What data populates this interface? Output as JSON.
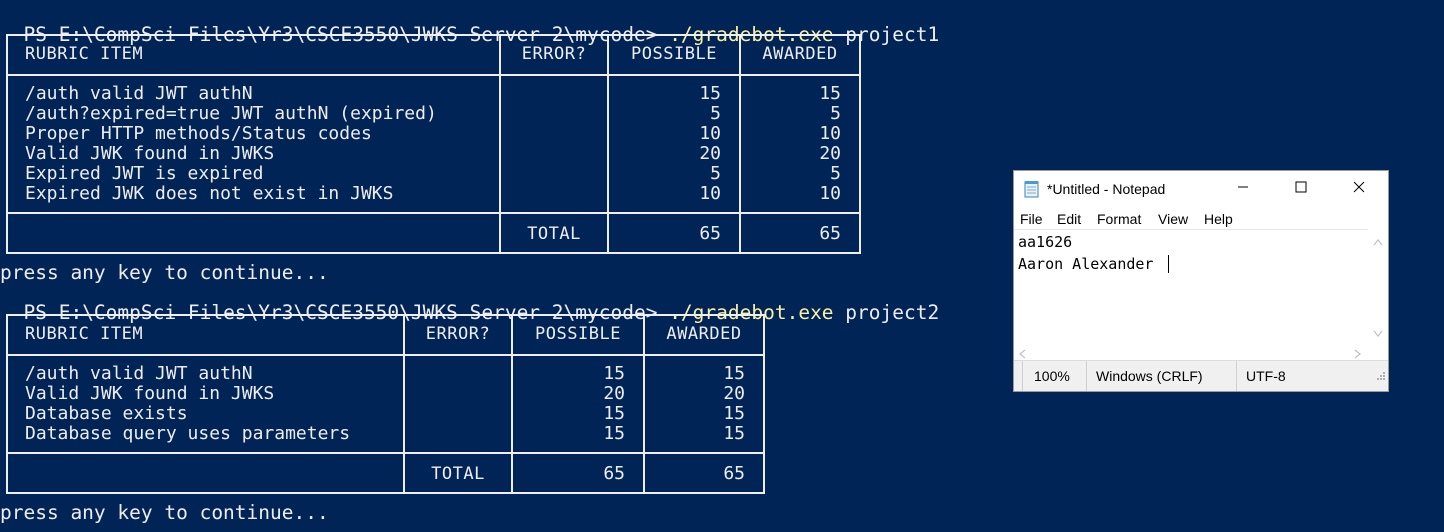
{
  "terminal": {
    "cmd1_prompt": "PS E:\\CompSci Files\\Yr3\\CSCE3550\\JWKS Server 2\\mycode> ",
    "cmd1_exe": "./gradebot.exe",
    "cmd1_arg": " project1",
    "cmd2_prompt": "PS E:\\CompSci Files\\Yr3\\CSCE3550\\JWKS Server 2\\mycode> ",
    "cmd2_exe": "./gradebot.exe",
    "cmd2_arg": " project2",
    "continue1": "press any key to continue...",
    "continue2": "press any key to continue...",
    "table1": {
      "headers": [
        "RUBRIC ITEM",
        "ERROR?",
        "POSSIBLE",
        "AWARDED"
      ],
      "rows": [
        {
          "item": "/auth valid JWT authN",
          "possible": "15",
          "awarded": "15"
        },
        {
          "item": "/auth?expired=true JWT authN (expired)",
          "possible": "5",
          "awarded": "5"
        },
        {
          "item": "Proper HTTP methods/Status codes",
          "possible": "10",
          "awarded": "10"
        },
        {
          "item": "Valid JWK found in JWKS",
          "possible": "20",
          "awarded": "20"
        },
        {
          "item": "Expired JWT is expired",
          "possible": "5",
          "awarded": "5"
        },
        {
          "item": "Expired JWK does not exist in JWKS",
          "possible": "10",
          "awarded": "10"
        }
      ],
      "total_label": "TOTAL",
      "total_possible": "65",
      "total_awarded": "65"
    },
    "table2": {
      "headers": [
        "RUBRIC ITEM",
        "ERROR?",
        "POSSIBLE",
        "AWARDED"
      ],
      "rows": [
        {
          "item": "/auth valid JWT authN",
          "possible": "15",
          "awarded": "15"
        },
        {
          "item": "Valid JWK found in JWKS",
          "possible": "20",
          "awarded": "20"
        },
        {
          "item": "Database exists",
          "possible": "15",
          "awarded": "15"
        },
        {
          "item": "Database query uses parameters",
          "possible": "15",
          "awarded": "15"
        }
      ],
      "total_label": "TOTAL",
      "total_possible": "65",
      "total_awarded": "65"
    }
  },
  "notepad": {
    "title": "*Untitled - Notepad",
    "menu": [
      "File",
      "Edit",
      "Format",
      "View",
      "Help"
    ],
    "lines": [
      "aa1626",
      "Aaron Alexander"
    ],
    "status": {
      "zoom": "100%",
      "line_ending": "Windows (CRLF)",
      "encoding": "UTF-8"
    },
    "icons": {
      "app": "notepad-icon",
      "minimize": "minimize-icon",
      "maximize": "maximize-icon",
      "close": "close-icon"
    }
  },
  "colors": {
    "terminal_bg": "#012456",
    "terminal_fg": "#eeedf0",
    "command": "#f9f1a5"
  }
}
